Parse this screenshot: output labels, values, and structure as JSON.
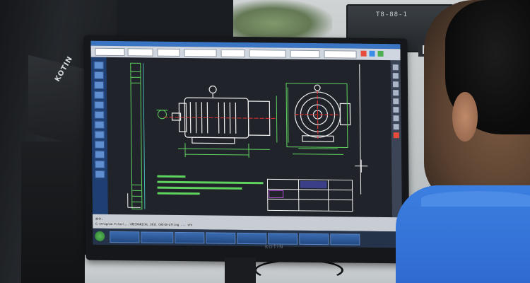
{
  "scene": {
    "pc_brand": "KOTIN",
    "back_monitor_text": "T8-88-1",
    "monitor_brand": "KOTIN"
  },
  "colors": {
    "cad_background": "#202329",
    "drawing_lines": "#f0f0f0",
    "annotation_green": "#5fd35f",
    "center_line_red": "#e03030",
    "ribbon": "#cfd6df",
    "taskbar": "#25334a",
    "shirt_blue": "#2f6ad0"
  },
  "cad": {
    "command_lines": [
      "命令:",
      "C:\\Program Files\\...\\MECHANICAL 2011 CHS\\Drafting ... sfn"
    ],
    "taskbar_items": [
      "",
      "",
      "",
      "",
      "",
      "",
      "",
      ""
    ],
    "clock_time": "",
    "clock_date": ""
  },
  "icons": [
    "windows-start-icon",
    "crosshair-cursor-icon",
    "ucs-axis-icon"
  ]
}
